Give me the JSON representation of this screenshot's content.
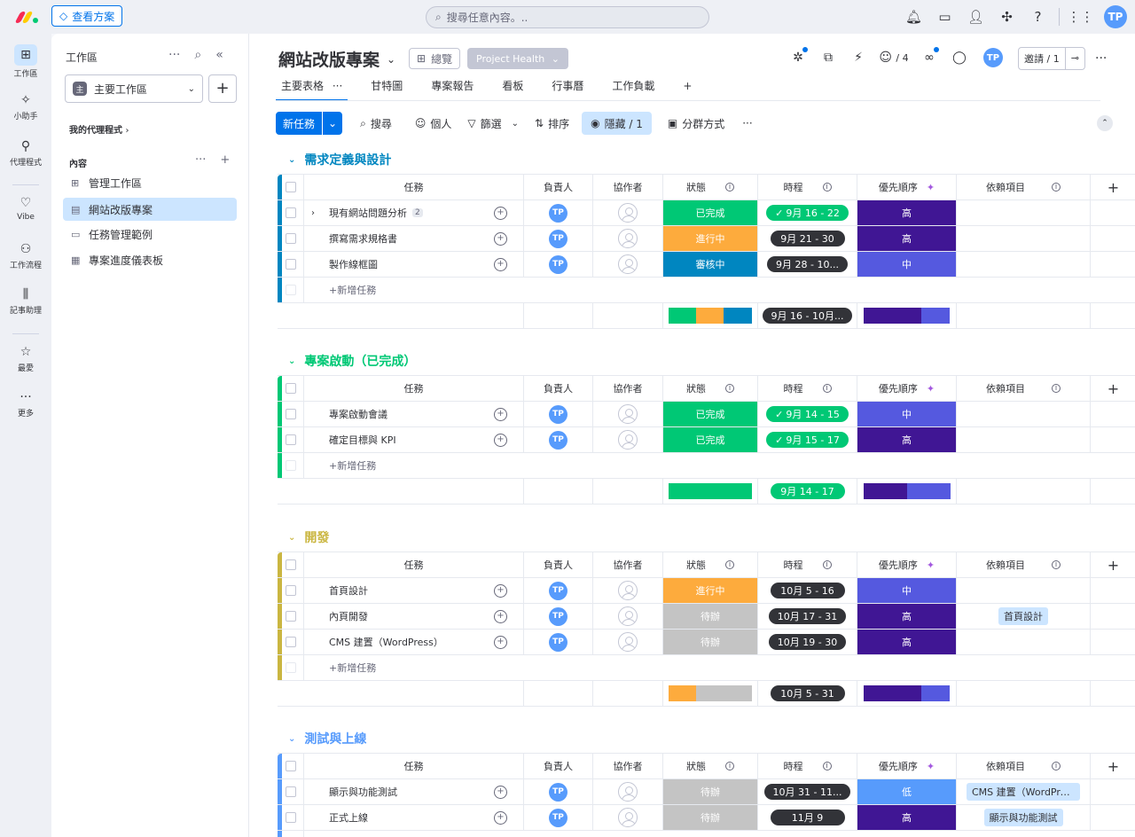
{
  "topbar": {
    "plans_label": "查看方案",
    "search_placeholder": "搜尋任意內容。..",
    "avatar": "TP"
  },
  "rail": [
    {
      "label": "工作區",
      "icon": "grid-icon"
    },
    {
      "label": "小助手",
      "icon": "sparkle-icon"
    },
    {
      "label": "代理程式",
      "icon": "agent-icon"
    },
    {
      "label": "Vibe",
      "icon": "heart-icon"
    },
    {
      "label": "工作流程",
      "icon": "workflow-icon"
    },
    {
      "label": "記事助理",
      "icon": "notetaker-icon"
    },
    {
      "label": "最愛",
      "icon": "star-icon"
    },
    {
      "label": "更多",
      "icon": "more-icon"
    }
  ],
  "sidebar": {
    "title": "工作區",
    "workspace_badge": "主",
    "workspace_name": "主要工作區",
    "my_agents": "我的代理程式",
    "content_heading": "內容",
    "items": [
      {
        "label": "管理工作區"
      },
      {
        "label": "網站改版專案"
      },
      {
        "label": "任務管理範例"
      },
      {
        "label": "專案進度儀表板"
      }
    ]
  },
  "board": {
    "title": "網站改版專案",
    "overview_label": "總覽",
    "health_label": "Project Health",
    "agents_count": "/ 4",
    "invite_label": "邀請 / 1",
    "tabs": [
      "主要表格",
      "甘特圖",
      "專案報告",
      "看板",
      "行事曆",
      "工作負載"
    ],
    "toolbar": {
      "new_task": "新任務",
      "search": "搜尋",
      "person": "個人",
      "filter": "篩選",
      "sort": "排序",
      "hidden": "隱藏 / 1",
      "group_by": "分群方式"
    }
  },
  "columns": {
    "task": "任務",
    "owner": "負責人",
    "collab": "協作者",
    "status": "狀態",
    "timeline": "時程",
    "priority": "優先順序",
    "depends": "依賴項目",
    "add_row": "+新增任務"
  },
  "groups": [
    {
      "title": "需求定義與設計",
      "color": "#0086c0",
      "rows": [
        {
          "task": "現有網站問題分析",
          "subitems": "2",
          "owner": "TP",
          "status": "已完成",
          "status_color": "#00c875",
          "timeline": "9月 16 - 22",
          "timeline_done": true,
          "priority": "高",
          "priority_color": "#401694",
          "depends": ""
        },
        {
          "task": "撰寫需求規格書",
          "owner": "TP",
          "status": "進行中",
          "status_color": "#fdab3d",
          "timeline": "9月 21 - 30",
          "timeline_done": false,
          "priority": "高",
          "priority_color": "#401694",
          "depends": ""
        },
        {
          "task": "製作線框圖",
          "owner": "TP",
          "status": "審核中",
          "status_color": "#0086c0",
          "timeline": "9月 28 - 10...",
          "timeline_done": false,
          "priority": "中",
          "priority_color": "#5559df",
          "depends": ""
        }
      ],
      "summary": {
        "timeline": "9月 16 - 10月...",
        "status_segments": [
          {
            "color": "#00c875",
            "pct": 33
          },
          {
            "color": "#fdab3d",
            "pct": 33
          },
          {
            "color": "#0086c0",
            "pct": 34
          }
        ],
        "priority_segments": [
          {
            "color": "#401694",
            "pct": 67
          },
          {
            "color": "#5559df",
            "pct": 33
          }
        ]
      }
    },
    {
      "title": "專案啟動（已完成）",
      "color": "#00c875",
      "rows": [
        {
          "task": "專案啟動會議",
          "owner": "TP",
          "status": "已完成",
          "status_color": "#00c875",
          "timeline": "9月 14 - 15",
          "timeline_done": true,
          "priority": "中",
          "priority_color": "#5559df",
          "depends": ""
        },
        {
          "task": "確定目標與 KPI",
          "owner": "TP",
          "status": "已完成",
          "status_color": "#00c875",
          "timeline": "9月 15 - 17",
          "timeline_done": true,
          "priority": "高",
          "priority_color": "#401694",
          "depends": ""
        }
      ],
      "summary": {
        "timeline": "9月 14 - 17",
        "timeline_done": true,
        "status_segments": [
          {
            "color": "#00c875",
            "pct": 100
          }
        ],
        "priority_segments": [
          {
            "color": "#401694",
            "pct": 50
          },
          {
            "color": "#5559df",
            "pct": 50
          }
        ]
      }
    },
    {
      "title": "開發",
      "color": "#cab641",
      "rows": [
        {
          "task": "首頁設計",
          "owner": "TP",
          "status": "進行中",
          "status_color": "#fdab3d",
          "timeline": "10月 5 - 16",
          "timeline_done": false,
          "priority": "中",
          "priority_color": "#5559df",
          "depends": ""
        },
        {
          "task": "內頁開發",
          "owner": "TP",
          "status": "待辦",
          "status_color": "#c4c4c4",
          "timeline": "10月 17 - 31",
          "timeline_done": false,
          "priority": "高",
          "priority_color": "#401694",
          "depends": "首頁設計"
        },
        {
          "task": "CMS 建置（WordPress）",
          "owner": "TP",
          "status": "待辦",
          "status_color": "#c4c4c4",
          "timeline": "10月 19 - 30",
          "timeline_done": false,
          "priority": "高",
          "priority_color": "#401694",
          "depends": ""
        }
      ],
      "summary": {
        "timeline": "10月 5 - 31",
        "status_segments": [
          {
            "color": "#fdab3d",
            "pct": 33
          },
          {
            "color": "#c4c4c4",
            "pct": 67
          }
        ],
        "priority_segments": [
          {
            "color": "#401694",
            "pct": 67
          },
          {
            "color": "#5559df",
            "pct": 33
          }
        ]
      }
    },
    {
      "title": "測試與上線",
      "color": "#579bfc",
      "rows": [
        {
          "task": "顯示與功能測試",
          "owner": "TP",
          "status": "待辦",
          "status_color": "#c4c4c4",
          "timeline": "10月 31 - 11...",
          "timeline_done": false,
          "priority": "低",
          "priority_color": "#579bfc",
          "depends": "CMS 建置（WordPre..."
        },
        {
          "task": "正式上線",
          "owner": "TP",
          "status": "待辦",
          "status_color": "#c4c4c4",
          "timeline": "11月 9",
          "timeline_done": false,
          "priority": "高",
          "priority_color": "#401694",
          "depends": "顯示與功能測試"
        }
      ]
    }
  ]
}
